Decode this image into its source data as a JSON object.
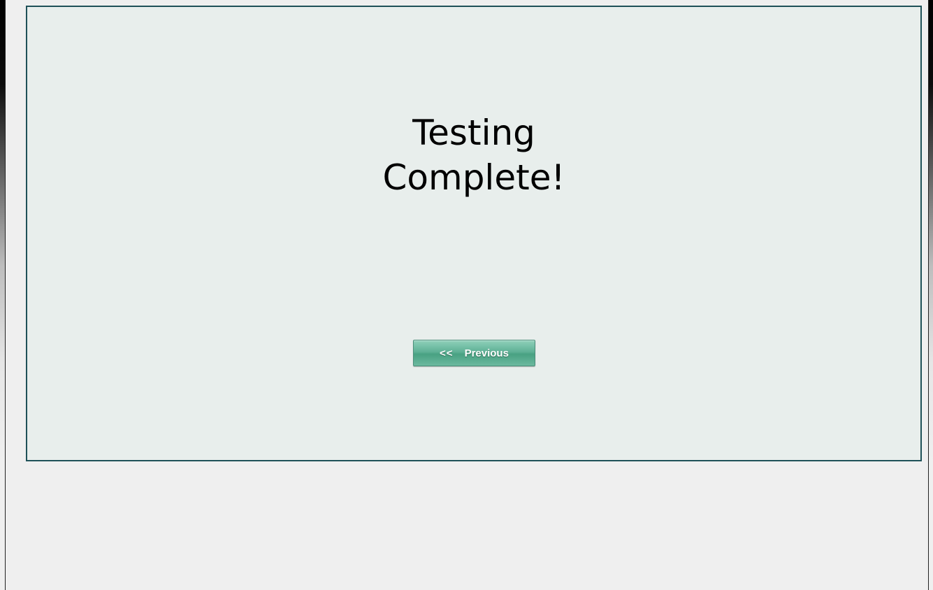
{
  "screen": {
    "headline_line1": "Testing",
    "headline_line2": "Complete!"
  },
  "navigation": {
    "previous_chevrons": "<<",
    "previous_label": "Previous"
  },
  "colors": {
    "panel_border": "#1f5158",
    "panel_background": "#e8eeec",
    "button_accent": "#5fb196"
  }
}
